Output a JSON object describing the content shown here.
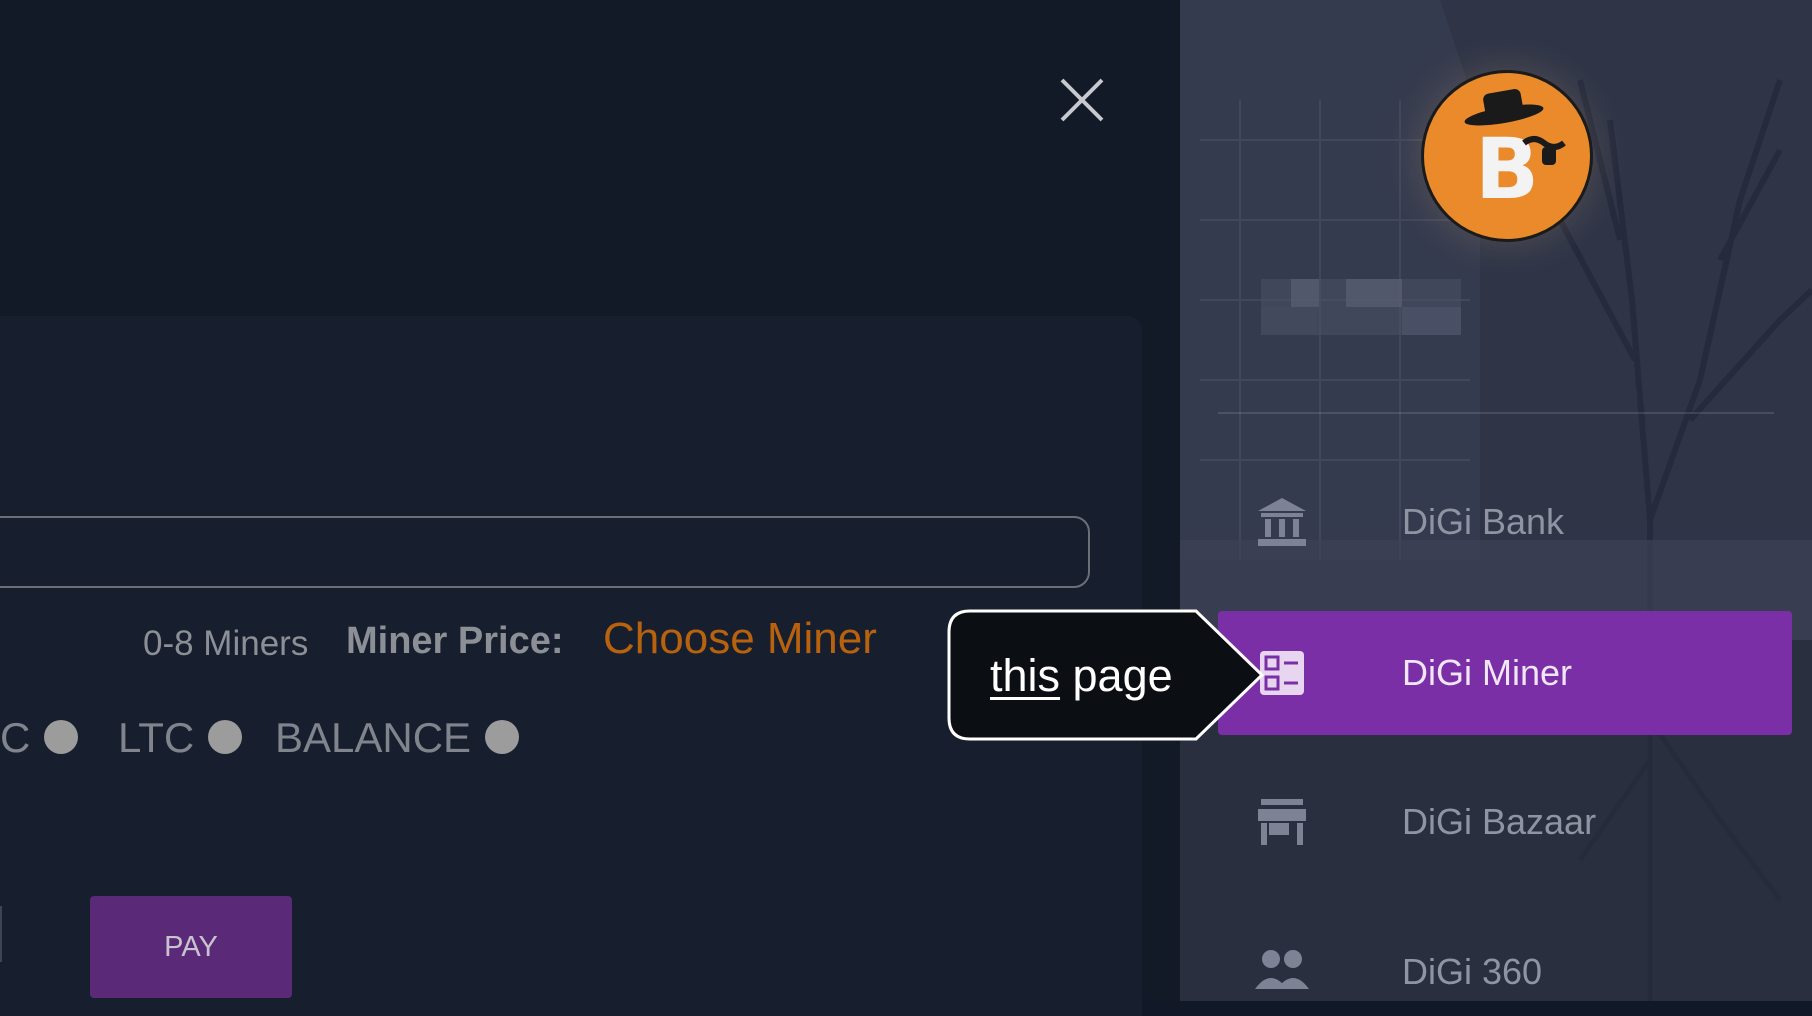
{
  "dialog": {
    "miners_range": "0-8 Miners",
    "miner_price_label": "Miner Price:",
    "miner_price_value": "Choose Miner",
    "payment_options": [
      "C",
      "LTC",
      "BALANCE"
    ],
    "pay_button": "PAY"
  },
  "sidebar": {
    "menu": [
      {
        "label": "DiGi Bank",
        "icon": "bank-icon"
      },
      {
        "label": "DiGi Miner",
        "icon": "miner-icon",
        "active": true
      },
      {
        "label": "DiGi Bazaar",
        "icon": "store-icon"
      },
      {
        "label": "DiGi 360",
        "icon": "people-icon"
      }
    ]
  },
  "annotation": {
    "underlined": "this",
    "rest": " page"
  },
  "colors": {
    "active_item": "#7b2fa6",
    "pay_button": "#5a2a78",
    "price_value": "#b8620e",
    "avatar": "#e98a2b"
  }
}
